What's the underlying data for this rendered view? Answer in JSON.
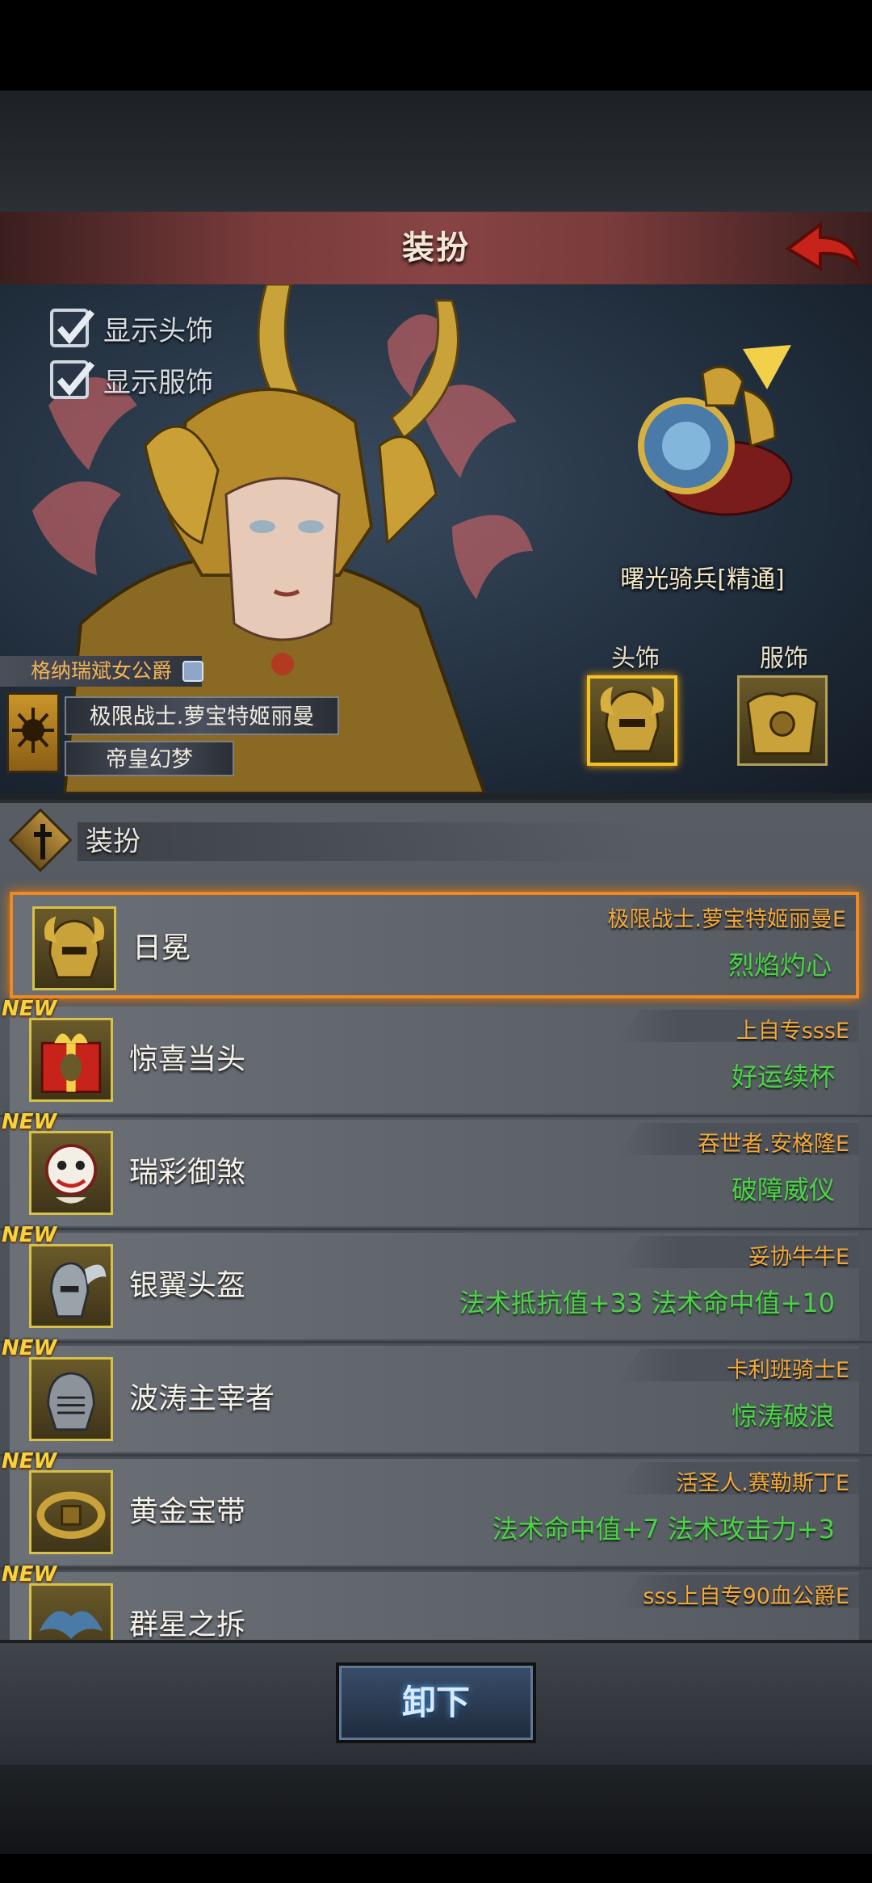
{
  "header": {
    "title": "装扮"
  },
  "hero": {
    "show_headwear_label": "显示头饰",
    "show_costume_label": "显示服饰",
    "mount_name": "曙光骑兵[精通]",
    "slot_headwear_label": "头饰",
    "slot_costume_label": "服饰",
    "title_label": "格纳瑞斌女公爵",
    "hero_name": "极限战士.萝宝特姬丽曼",
    "hero_sub": "帝皇幻梦"
  },
  "section": {
    "title": "装扮"
  },
  "items": [
    {
      "name": "日冕",
      "owner": "极限战士.萝宝特姬丽曼E",
      "attr": "烈焰灼心",
      "new": ""
    },
    {
      "name": "惊喜当头",
      "owner": "上自专sssE",
      "attr": "好运续杯",
      "new": "NEW"
    },
    {
      "name": "瑞彩御煞",
      "owner": "吞世者.安格隆E",
      "attr": "破障威仪",
      "new": "NEW"
    },
    {
      "name": "银翼头盔",
      "owner": "妥协牛牛E",
      "attr": "法术抵抗值+33  法术命中值+10",
      "new": "NEW"
    },
    {
      "name": "波涛主宰者",
      "owner": "卡利班骑士E",
      "attr": "惊涛破浪",
      "new": "NEW"
    },
    {
      "name": "黄金宝带",
      "owner": "活圣人.赛勒斯丁E",
      "attr": "法术命中值+7  法术攻击力+3",
      "new": "NEW"
    },
    {
      "name": "群星之拆",
      "owner": "sss上自专90血公爵E",
      "attr": "",
      "new": "NEW"
    }
  ],
  "bottom": {
    "unequip_label": "卸下"
  },
  "colors": {
    "accent_gold": "#f2c229",
    "owner_orange": "#f3a93a",
    "attr_green": "#4fd04a",
    "header_red": "#874444"
  }
}
